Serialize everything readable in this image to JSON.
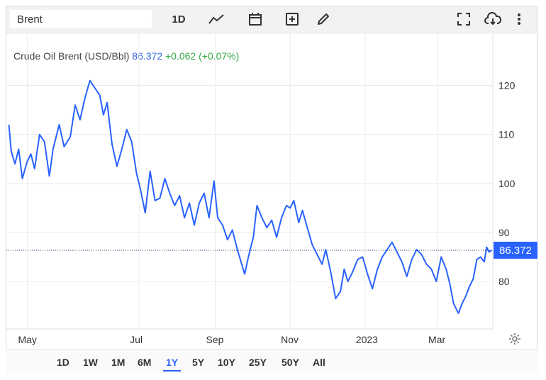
{
  "toolbar": {
    "search_value": "Brent",
    "interval_label": "1D",
    "icons": [
      "line-chart-icon",
      "calendar-icon",
      "add-indicator-icon",
      "pencil-icon",
      "fullscreen-icon",
      "cloud-download-icon",
      "more-vertical-icon"
    ]
  },
  "legend": {
    "name": "Crude Oil Brent (USD/Bbl)",
    "price": "86.372",
    "change": "+0.062 (+0.07%)"
  },
  "range_buttons": [
    "1D",
    "1W",
    "1M",
    "6M",
    "1Y",
    "5Y",
    "10Y",
    "25Y",
    "50Y",
    "All"
  ],
  "active_range": "1Y",
  "colors": {
    "line": "#2962ff",
    "change_up": "#33aa44",
    "price_label_bg": "#2962ff"
  },
  "chart_data": {
    "type": "line",
    "title": "Crude Oil Brent (USD/Bbl)",
    "xlabel": "",
    "ylabel": "",
    "y_ticks": [
      80,
      90,
      100,
      110,
      120
    ],
    "x_ticks": [
      {
        "label": "May",
        "date": "2022-04-01"
      },
      {
        "label": "Jul",
        "date": "2022-07-01"
      },
      {
        "label": "Sep",
        "date": "2022-09-01"
      },
      {
        "label": "Nov",
        "date": "2022-11-01"
      },
      {
        "label": "2023",
        "date": "2023-01-01"
      },
      {
        "label": "Mar",
        "date": "2023-03-01"
      }
    ],
    "ylim": [
      70.3,
      130.5
    ],
    "xlim": [
      "2022-03-15",
      "2023-04-15"
    ],
    "last_value": 86.372,
    "grid": true,
    "series": [
      {
        "name": "Crude Oil Brent",
        "points": [
          [
            "2022-03-17",
            112.0
          ],
          [
            "2022-03-19",
            106.5
          ],
          [
            "2022-03-22",
            104.0
          ],
          [
            "2022-03-25",
            107.0
          ],
          [
            "2022-03-28",
            101.0
          ],
          [
            "2022-04-01",
            104.5
          ],
          [
            "2022-04-04",
            106.0
          ],
          [
            "2022-04-07",
            103.0
          ],
          [
            "2022-04-11",
            110.0
          ],
          [
            "2022-04-15",
            108.5
          ],
          [
            "2022-04-19",
            101.5
          ],
          [
            "2022-04-22",
            107.0
          ],
          [
            "2022-04-27",
            112.0
          ],
          [
            "2022-05-01",
            107.5
          ],
          [
            "2022-05-06",
            109.5
          ],
          [
            "2022-05-10",
            116.0
          ],
          [
            "2022-05-14",
            113.0
          ],
          [
            "2022-05-18",
            117.5
          ],
          [
            "2022-05-22",
            121.0
          ],
          [
            "2022-05-26",
            119.5
          ],
          [
            "2022-05-30",
            118.0
          ],
          [
            "2022-06-02",
            114.0
          ],
          [
            "2022-06-05",
            116.5
          ],
          [
            "2022-06-09",
            108.0
          ],
          [
            "2022-06-13",
            103.5
          ],
          [
            "2022-06-17",
            107.0
          ],
          [
            "2022-06-21",
            111.0
          ],
          [
            "2022-06-25",
            108.5
          ],
          [
            "2022-06-29",
            102.0
          ],
          [
            "2022-07-02",
            99.0
          ],
          [
            "2022-07-06",
            94.0
          ],
          [
            "2022-07-10",
            102.5
          ],
          [
            "2022-07-14",
            96.5
          ],
          [
            "2022-07-18",
            97.0
          ],
          [
            "2022-07-22",
            101.0
          ],
          [
            "2022-07-26",
            98.0
          ],
          [
            "2022-07-30",
            95.5
          ],
          [
            "2022-08-03",
            97.5
          ],
          [
            "2022-08-07",
            93.0
          ],
          [
            "2022-08-11",
            96.0
          ],
          [
            "2022-08-15",
            91.5
          ],
          [
            "2022-08-19",
            96.0
          ],
          [
            "2022-08-23",
            98.0
          ],
          [
            "2022-08-27",
            93.0
          ],
          [
            "2022-08-31",
            100.5
          ],
          [
            "2022-09-03",
            93.0
          ],
          [
            "2022-09-07",
            91.5
          ],
          [
            "2022-09-11",
            88.5
          ],
          [
            "2022-09-15",
            90.5
          ],
          [
            "2022-09-19",
            86.5
          ],
          [
            "2022-09-22",
            84.0
          ],
          [
            "2022-09-25",
            81.5
          ],
          [
            "2022-09-28",
            85.0
          ],
          [
            "2022-10-02",
            89.0
          ],
          [
            "2022-10-05",
            95.5
          ],
          [
            "2022-10-09",
            93.0
          ],
          [
            "2022-10-13",
            91.0
          ],
          [
            "2022-10-17",
            92.5
          ],
          [
            "2022-10-21",
            89.0
          ],
          [
            "2022-10-25",
            93.0
          ],
          [
            "2022-10-29",
            95.5
          ],
          [
            "2022-11-01",
            95.0
          ],
          [
            "2022-11-04",
            96.5
          ],
          [
            "2022-11-08",
            92.0
          ],
          [
            "2022-11-11",
            94.5
          ],
          [
            "2022-11-15",
            91.0
          ],
          [
            "2022-11-19",
            87.5
          ],
          [
            "2022-11-23",
            85.5
          ],
          [
            "2022-11-27",
            83.5
          ],
          [
            "2022-11-30",
            86.5
          ],
          [
            "2022-12-04",
            82.0
          ],
          [
            "2022-12-08",
            76.5
          ],
          [
            "2022-12-12",
            78.0
          ],
          [
            "2022-12-15",
            82.5
          ],
          [
            "2022-12-18",
            80.0
          ],
          [
            "2022-12-22",
            82.0
          ],
          [
            "2022-12-26",
            84.5
          ],
          [
            "2022-12-30",
            85.0
          ],
          [
            "2023-01-03",
            81.5
          ],
          [
            "2023-01-07",
            78.5
          ],
          [
            "2023-01-11",
            82.5
          ],
          [
            "2023-01-15",
            85.0
          ],
          [
            "2023-01-19",
            86.5
          ],
          [
            "2023-01-23",
            88.0
          ],
          [
            "2023-01-27",
            86.0
          ],
          [
            "2023-01-31",
            84.0
          ],
          [
            "2023-02-04",
            81.0
          ],
          [
            "2023-02-08",
            84.5
          ],
          [
            "2023-02-12",
            86.5
          ],
          [
            "2023-02-16",
            85.5
          ],
          [
            "2023-02-20",
            83.5
          ],
          [
            "2023-02-24",
            82.5
          ],
          [
            "2023-02-28",
            80.0
          ],
          [
            "2023-03-04",
            85.0
          ],
          [
            "2023-03-08",
            82.5
          ],
          [
            "2023-03-11",
            79.5
          ],
          [
            "2023-03-14",
            75.5
          ],
          [
            "2023-03-18",
            73.5
          ],
          [
            "2023-03-21",
            75.5
          ],
          [
            "2023-03-24",
            77.0
          ],
          [
            "2023-03-27",
            79.0
          ],
          [
            "2023-03-30",
            80.5
          ],
          [
            "2023-04-02",
            84.5
          ],
          [
            "2023-04-05",
            85.0
          ],
          [
            "2023-04-08",
            84.0
          ],
          [
            "2023-04-10",
            87.0
          ],
          [
            "2023-04-12",
            86.0
          ],
          [
            "2023-04-14",
            86.372
          ]
        ]
      }
    ]
  }
}
